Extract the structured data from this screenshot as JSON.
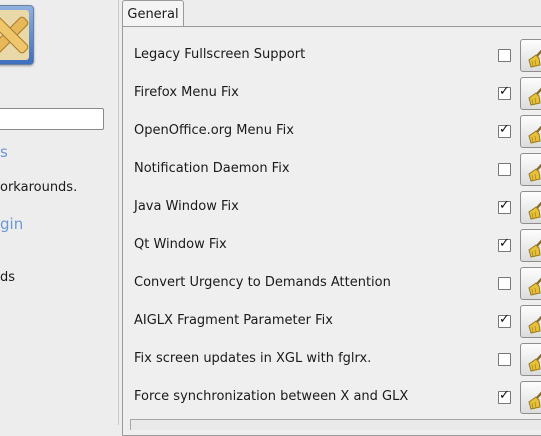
{
  "sidebar": {
    "link_1": "s",
    "description": "orkarounds.",
    "link_2": "gin",
    "text_3": "ds"
  },
  "tabs": [
    {
      "label": "General"
    }
  ],
  "options": [
    {
      "label": "Legacy Fullscreen Support",
      "checked": false
    },
    {
      "label": "Firefox Menu Fix",
      "checked": true
    },
    {
      "label": "OpenOffice.org Menu Fix",
      "checked": true
    },
    {
      "label": "Notification Daemon Fix",
      "checked": false
    },
    {
      "label": "Java Window Fix",
      "checked": true
    },
    {
      "label": "Qt Window Fix",
      "checked": true
    },
    {
      "label": "Convert Urgency to Demands Attention",
      "checked": false
    },
    {
      "label": "AIGLX Fragment Parameter Fix",
      "checked": true
    },
    {
      "label": "Fix screen updates in XGL with fglrx.",
      "checked": false
    },
    {
      "label": "Force synchronization between X and GLX",
      "checked": true
    }
  ],
  "icons": {
    "plugin": "workarounds-plugin-icon",
    "reset": "broom-reset-icon",
    "check": "✓"
  },
  "colors": {
    "link": "#6d98d6",
    "accent": "#3e6fbd"
  }
}
